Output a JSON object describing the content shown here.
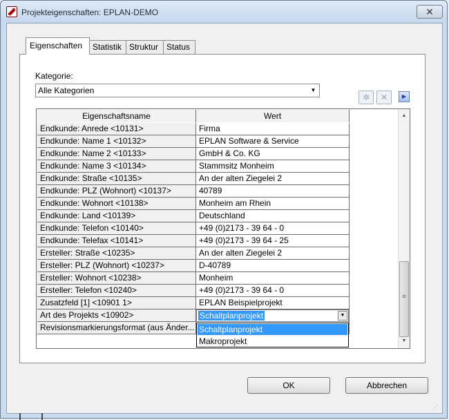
{
  "window": {
    "title": "Projekteigenschaften: EPLAN-DEMO",
    "close_label": "✕"
  },
  "tabs": [
    {
      "label": "Eigenschaften",
      "active": true
    },
    {
      "label": "Statistik",
      "active": false
    },
    {
      "label": "Struktur",
      "active": false
    },
    {
      "label": "Status",
      "active": false
    }
  ],
  "category": {
    "label": "Kategorie:",
    "value": "Alle Kategorien"
  },
  "grid": {
    "header_name": "Eigenschaftsname",
    "header_value": "Wert",
    "rows": [
      {
        "name": "Endkunde: Anrede <10131>",
        "value": "Firma"
      },
      {
        "name": "Endkunde: Name 1 <10132>",
        "value": "EPLAN Software & Service"
      },
      {
        "name": "Endkunde: Name 2 <10133>",
        "value": "GmbH & Co. KG"
      },
      {
        "name": "Endkunde: Name 3 <10134>",
        "value": "Stammsitz Monheim"
      },
      {
        "name": "Endkunde: Straße <10135>",
        "value": "An der alten Ziegelei 2"
      },
      {
        "name": "Endkunde: PLZ (Wohnort) <10137>",
        "value": "40789"
      },
      {
        "name": "Endkunde: Wohnort <10138>",
        "value": "Monheim am Rhein"
      },
      {
        "name": "Endkunde: Land <10139>",
        "value": "Deutschland"
      },
      {
        "name": "Endkunde: Telefon <10140>",
        "value": "+49 (0)2173 - 39 64 - 0"
      },
      {
        "name": "Endkunde: Telefax <10141>",
        "value": "+49 (0)2173 - 39 64 - 25"
      },
      {
        "name": "Ersteller: Straße <10235>",
        "value": "An der alten Ziegelei 2"
      },
      {
        "name": "Ersteller: PLZ (Wohnort) <10237>",
        "value": "D-40789"
      },
      {
        "name": "Ersteller: Wohnort <10238>",
        "value": "Monheim"
      },
      {
        "name": "Ersteller: Telefon <10240>",
        "value": "+49 (0)2173 - 39 64 - 0"
      },
      {
        "name": "Zusatzfeld [1] <10901 1>",
        "value": "EPLAN Beispielprojekt"
      },
      {
        "name": "Art des Projekts <10902>",
        "value": ""
      },
      {
        "name": "Revisionsmarkierungsformat (aus Änder...",
        "value": ""
      }
    ],
    "editor_value": "Schaltplanprojekt",
    "dropdown_options": [
      "Schaltplanprojekt",
      "Makroprojekt"
    ]
  },
  "buttons": {
    "ok": "OK",
    "cancel": "Abbrechen"
  }
}
